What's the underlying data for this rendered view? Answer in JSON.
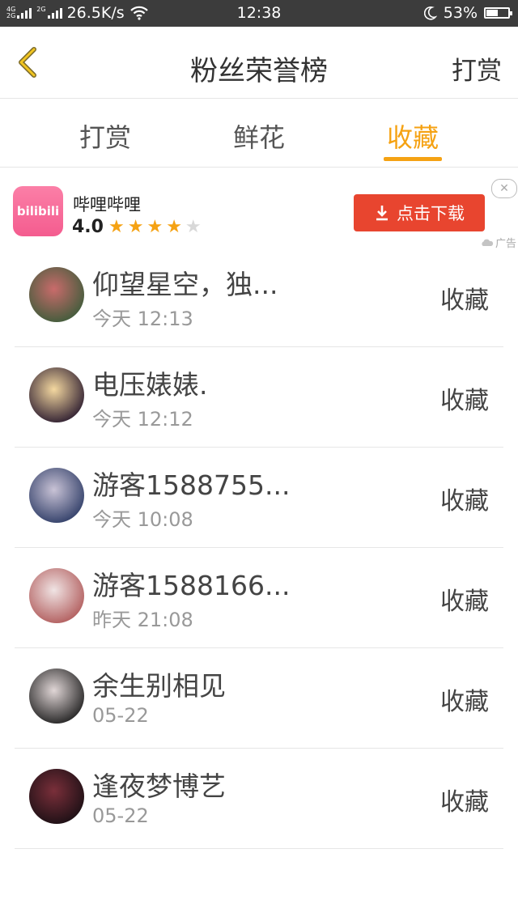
{
  "status_bar": {
    "network_a": "4G",
    "network_b": "2G",
    "network_c": "2G",
    "speed": "26.5K/s",
    "time": "12:38",
    "battery": "53%",
    "battery_level": 0.53
  },
  "header": {
    "title": "粉丝荣誉榜",
    "right_action": "打赏"
  },
  "tabs": [
    {
      "label": "打赏",
      "active": false
    },
    {
      "label": "鲜花",
      "active": false
    },
    {
      "label": "收藏",
      "active": true
    }
  ],
  "ad": {
    "icon_text": "bilibili",
    "app_name": "哔哩哔哩",
    "rating": "4.0",
    "stars_filled": 4,
    "stars_total": 5,
    "button_label": "点击下载",
    "tag": "广告",
    "close": "✕"
  },
  "fans": [
    {
      "name": "仰望星空，独...",
      "time": "今天 12:13",
      "action": "收藏",
      "avatar_colors": [
        "#c96b6b",
        "#3d5c3a"
      ]
    },
    {
      "name": "电压婊婊.",
      "time": "今天 12:12",
      "action": "收藏",
      "avatar_colors": [
        "#f4d8a0",
        "#2a1a2e"
      ]
    },
    {
      "name": "游客1588755...",
      "time": "今天 10:08",
      "action": "收藏",
      "avatar_colors": [
        "#c9c3d6",
        "#2e3c66"
      ]
    },
    {
      "name": "游客1588166...",
      "time": "昨天 21:08",
      "action": "收藏",
      "avatar_colors": [
        "#f0e4e4",
        "#b05a5a"
      ]
    },
    {
      "name": "余生别相见",
      "time": "05-22",
      "action": "收藏",
      "avatar_colors": [
        "#e0d6d6",
        "#1f1f1f"
      ]
    },
    {
      "name": "逢夜梦博艺",
      "time": "05-22",
      "action": "收藏",
      "avatar_colors": [
        "#7a2f3a",
        "#1a0f14"
      ]
    }
  ],
  "colors": {
    "accent": "#f5a213",
    "ad_button": "#e8452f",
    "status_bar": "#3c3c3c"
  }
}
